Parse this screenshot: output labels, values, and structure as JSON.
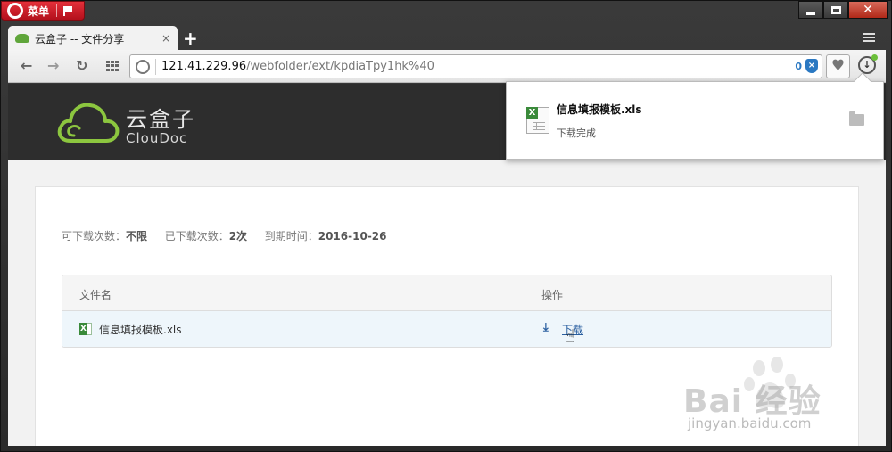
{
  "browser": {
    "menu_label": "菜单",
    "tab_title": "云盒子 -- 文件分享",
    "tab_close": "×",
    "new_tab": "+",
    "url_host": "121.41.229.96",
    "url_path": "/webfolder/ext/kpdiaTpy1hk%40",
    "blocked_count": "0",
    "close_glyph": "✕"
  },
  "site": {
    "brand_cn": "云盒子",
    "brand_en": "ClouDoc",
    "accent_color": "#8cc63f"
  },
  "share": {
    "downloads_allowed_label": "可下载次数：",
    "downloads_allowed_value": "不限",
    "downloaded_label": "已下载次数：",
    "downloaded_value": "2次",
    "expires_label": "到期时间：",
    "expires_value": "2016-10-26"
  },
  "table": {
    "headers": [
      "文件名",
      "操作"
    ],
    "rows": [
      {
        "file_name": "信息填报模板.xls",
        "action": "下载"
      }
    ]
  },
  "download_popup": {
    "file_name": "信息填报模板.xls",
    "status": "下载完成"
  },
  "watermark": {
    "text": "Bai 经验",
    "url": "jingyan.baidu.com"
  }
}
